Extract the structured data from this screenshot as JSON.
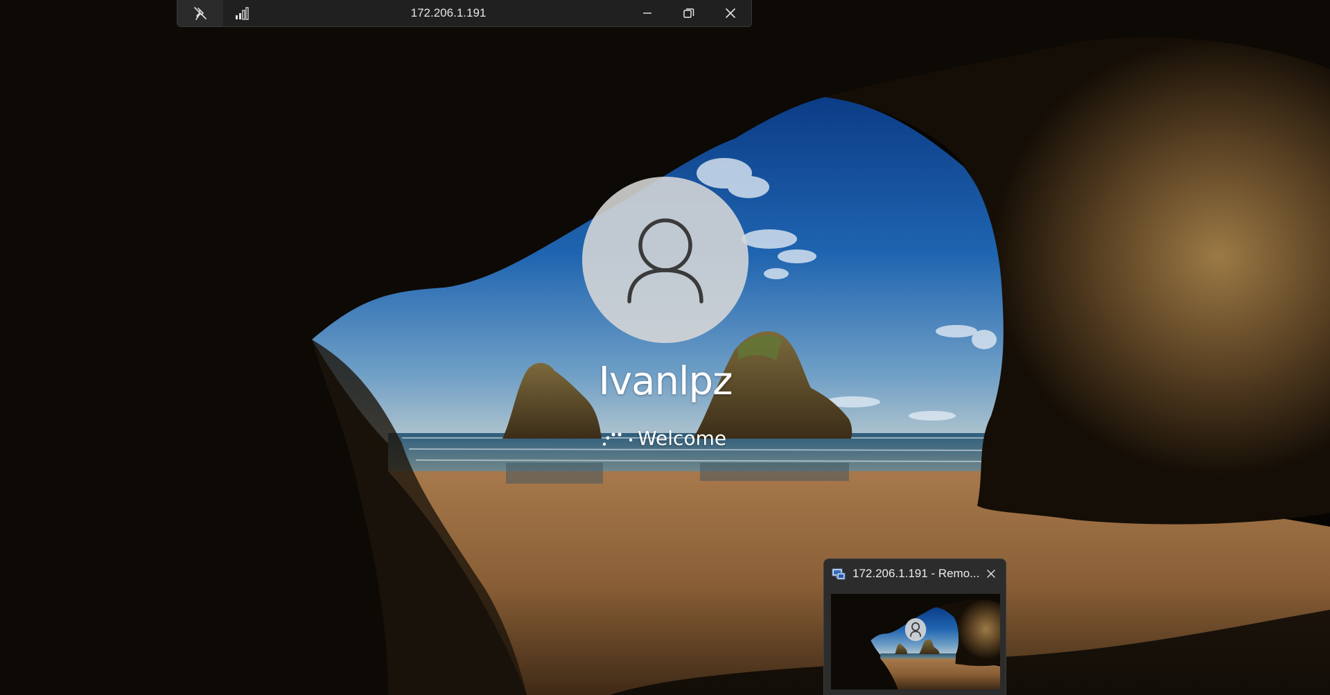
{
  "connection_bar": {
    "host": "172.206.1.191",
    "pin_icon": "pin-off-icon",
    "signal_icon": "signal-strength-icon",
    "minimize_icon": "minimize-icon",
    "restore_icon": "restore-icon",
    "close_icon": "close-icon"
  },
  "login": {
    "avatar_icon": "user-icon",
    "username": "Ivanlpz",
    "status": "Welcome",
    "spinner_icon": "loading-spinner-icon"
  },
  "taskbar_preview": {
    "app_icon": "remote-desktop-icon",
    "title": "172.206.1.191 - Remo...",
    "close_icon": "close-icon"
  },
  "colors": {
    "connection_bar_bg": "#202020",
    "preview_bg": "#2c2c2c",
    "text": "#ffffff",
    "sky": "#1f64b0",
    "sand": "#b07a45",
    "cave_rock": "#5a4326"
  }
}
